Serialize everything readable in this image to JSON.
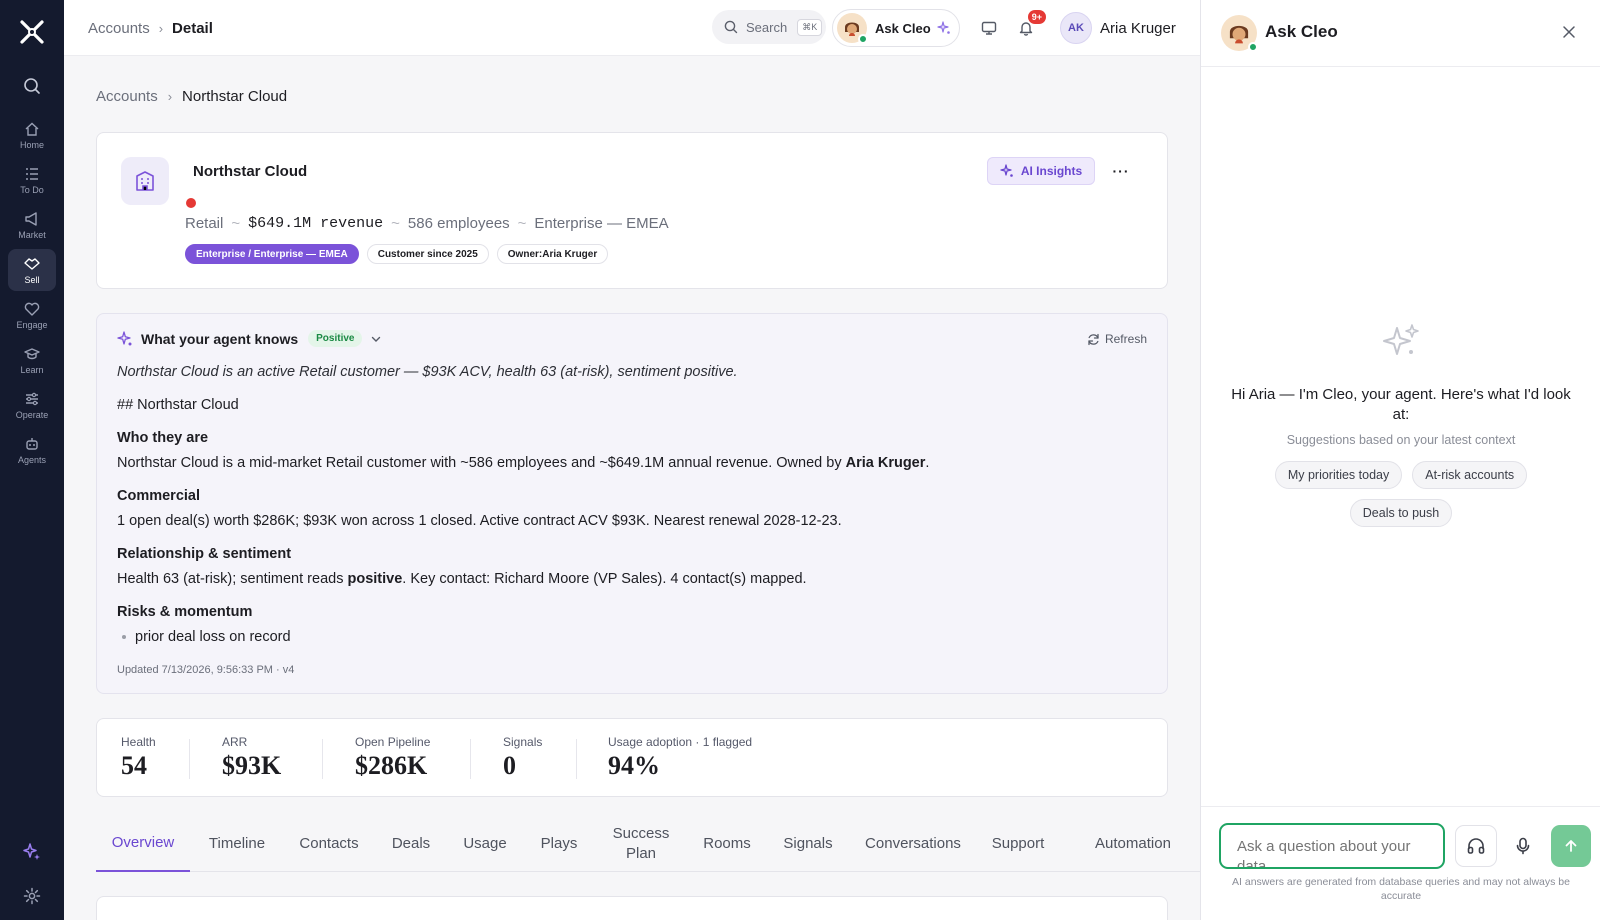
{
  "topbar": {
    "breadcrumb_root": "Accounts",
    "breadcrumb_current": "Detail",
    "search_label": "Search",
    "search_shortcut": "⌘K",
    "ask_cleo_label": "Ask Cleo",
    "notifications_badge": "9+",
    "user_initials": "AK",
    "user_name": "Aria Kruger"
  },
  "nav": {
    "items": [
      {
        "label": "Home",
        "icon": "home-icon"
      },
      {
        "label": "To Do",
        "icon": "todo-icon"
      },
      {
        "label": "Market",
        "icon": "megaphone-icon"
      },
      {
        "label": "Sell",
        "icon": "handshake-icon",
        "active": true
      },
      {
        "label": "Engage",
        "icon": "heart-icon"
      },
      {
        "label": "Learn",
        "icon": "graduation-cap-icon"
      },
      {
        "label": "Operate",
        "icon": "sliders-icon"
      },
      {
        "label": "Agents",
        "icon": "robot-icon"
      }
    ]
  },
  "page": {
    "breadcrumb_root": "Accounts",
    "breadcrumb_current": "Northstar Cloud"
  },
  "account": {
    "name": "Northstar Cloud",
    "industry": "Retail",
    "revenue": "$649.1M revenue",
    "employees": "586 employees",
    "segment": "Enterprise — EMEA",
    "tags": [
      "Enterprise / Enterprise — EMEA",
      "Customer since 2025",
      "Owner:Aria Kruger"
    ],
    "ai_insights_label": "AI Insights",
    "more_label": "···"
  },
  "agent_knows": {
    "title": "What your agent knows",
    "sentiment_badge": "Positive",
    "refresh_label": "Refresh",
    "summary": "Northstar Cloud is an active Retail customer — $93K ACV, health 63 (at-risk), sentiment positive.",
    "heading": "## Northstar Cloud",
    "who_heading": "Who they are",
    "who_text": "Northstar Cloud is a mid-market Retail customer with ~586 employees and ~$649.1M annual revenue. Owned by ",
    "who_owner": "Aria Kruger",
    "who_end": ".",
    "commercial_heading": "Commercial",
    "commercial_text": "1 open deal(s) worth $286K; $93K won across 1 closed. Active contract ACV $93K. Nearest renewal 2028-12-23.",
    "relationship_heading": "Relationship & sentiment",
    "relationship_text_a": "Health 63 (at-risk); sentiment reads ",
    "relationship_bold": "positive",
    "relationship_text_b": ". Key contact: Richard Moore (VP Sales). 4 contact(s) mapped.",
    "risks_heading": "Risks & momentum",
    "risks": [
      "prior deal loss on record"
    ],
    "updated": "Updated 7/13/2026, 9:56:33 PM · v4"
  },
  "stats": [
    {
      "label": "Health",
      "value": "54"
    },
    {
      "label": "ARR",
      "value": "$93K"
    },
    {
      "label": "Open Pipeline",
      "value": "$286K"
    },
    {
      "label": "Signals",
      "value": "0"
    },
    {
      "label": "Usage adoption · 1 flagged",
      "value": "94%"
    }
  ],
  "tabs": [
    "Overview",
    "Timeline",
    "Contacts",
    "Deals",
    "Usage",
    "Plays",
    "Success Plan",
    "Rooms",
    "Signals",
    "Conversations",
    "Support",
    "Automation"
  ],
  "active_tab": "Overview",
  "panel": {
    "title": "Ask Cleo",
    "greeting": "Hi Aria — I'm Cleo, your agent. Here's what I'd look at:",
    "subtitle": "Suggestions based on your latest context",
    "suggestions": [
      "My priorities today",
      "At-risk accounts",
      "Deals to push"
    ],
    "input_placeholder": "Ask a question about your data...",
    "disclaimer": "AI answers are generated from database queries and may not always be accurate"
  },
  "colors": {
    "accent": "#7b53d9",
    "rail": "#141a2e",
    "online": "#1fa463",
    "alert": "#e53935"
  }
}
